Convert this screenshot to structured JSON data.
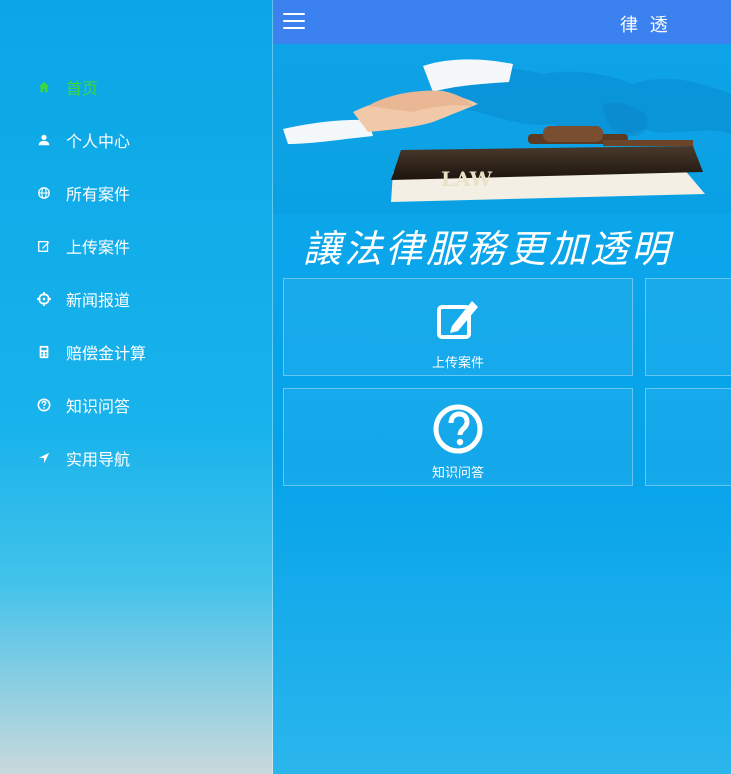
{
  "header": {
    "title": "律 透"
  },
  "sidebar": {
    "items": [
      {
        "label": "首页",
        "icon": "home-icon",
        "active": true
      },
      {
        "label": "个人中心",
        "icon": "user-icon",
        "active": false
      },
      {
        "label": "所有案件",
        "icon": "globe-icon",
        "active": false
      },
      {
        "label": "上传案件",
        "icon": "edit-icon",
        "active": false
      },
      {
        "label": "新闻报道",
        "icon": "crosshair-icon",
        "active": false
      },
      {
        "label": "赔偿金计算",
        "icon": "calculator-icon",
        "active": false
      },
      {
        "label": "知识问答",
        "icon": "question-circle-icon",
        "active": false
      },
      {
        "label": "实用导航",
        "icon": "location-arrow-icon",
        "active": false
      }
    ]
  },
  "banner": {
    "book_text": "LAW",
    "slogan": "讓法律服務更加透明"
  },
  "tiles": [
    {
      "label": "上传案件",
      "icon": "edit-icon"
    },
    {
      "label": "知识问答",
      "icon": "question-circle-icon"
    }
  ],
  "colors": {
    "accent": "#3b82f0",
    "active_menu": "#3cd83c"
  }
}
